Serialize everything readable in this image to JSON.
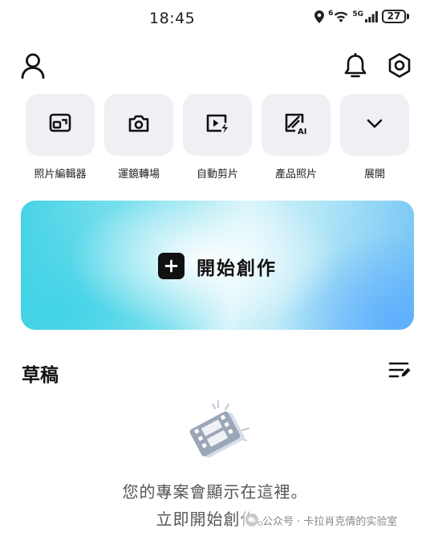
{
  "status_bar": {
    "time": "18:45",
    "wifi_badge": "6",
    "network_label": "5G",
    "battery": "27",
    "icons": [
      "location-icon",
      "wifi-icon",
      "cellular-signal-icon",
      "battery-icon"
    ]
  },
  "header": {
    "icons": [
      "profile-icon",
      "bell-icon",
      "settings-gear-icon"
    ]
  },
  "tools": [
    {
      "label": "照片編輯器",
      "icon": "photo-edit-icon"
    },
    {
      "label": "運鏡轉場",
      "icon": "camera-icon"
    },
    {
      "label": "自動剪片",
      "icon": "auto-cut-icon"
    },
    {
      "label": "產品照片",
      "icon": "ai-product-photo-icon"
    },
    {
      "label": "展開",
      "icon": "chevron-down-icon"
    }
  ],
  "create_banner": {
    "label": "開始創作",
    "icon": "plus-icon"
  },
  "drafts": {
    "title": "草稿",
    "sort_icon": "sort-edit-icon",
    "empty_line1": "您的專案會顯示在這裡。",
    "empty_line2": "立即開始創作。",
    "illustration": "film-strip-icon"
  },
  "watermark": {
    "text": "公众号 · 卡拉肖克倩的实验室"
  },
  "colors": {
    "tile_bg": "#eef0f4",
    "banner_cyan": "#45d3e6",
    "banner_blue": "#72c3f5",
    "text_primary": "#111111",
    "text_muted": "#555555"
  }
}
